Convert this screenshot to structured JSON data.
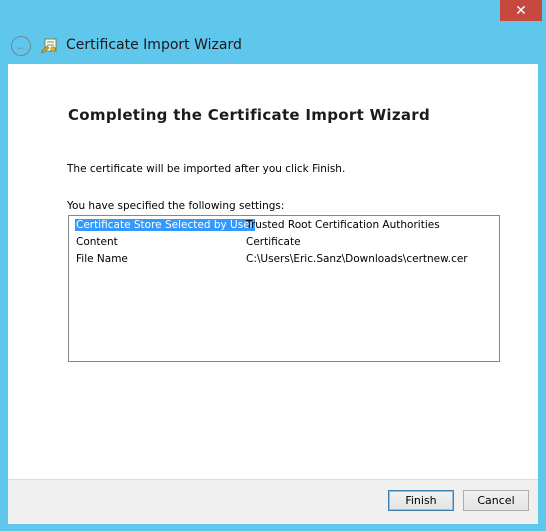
{
  "window": {
    "title": "Certificate Import Wizard",
    "close_glyph": "✕",
    "back_glyph": "←",
    "icons": {
      "back": "back-arrow-icon",
      "wizard": "certificate-wizard-icon",
      "close": "close-icon"
    }
  },
  "page": {
    "heading": "Completing the Certificate Import Wizard",
    "intro": "The certificate will be imported after you click Finish.",
    "settings_label": "You have specified the following settings:"
  },
  "settings": [
    {
      "key": "Certificate Store Selected by User",
      "value": "Trusted Root Certification Authorities",
      "selected": true
    },
    {
      "key": "Content",
      "value": "Certificate",
      "selected": false
    },
    {
      "key": "File Name",
      "value": "C:\\Users\\Eric.Sanz\\Downloads\\certnew.cer",
      "selected": false
    }
  ],
  "buttons": {
    "finish": "Finish",
    "cancel": "Cancel"
  },
  "colors": {
    "frame": "#5fc6ec",
    "close_button": "#c7483f",
    "selection": "#3399ff"
  }
}
